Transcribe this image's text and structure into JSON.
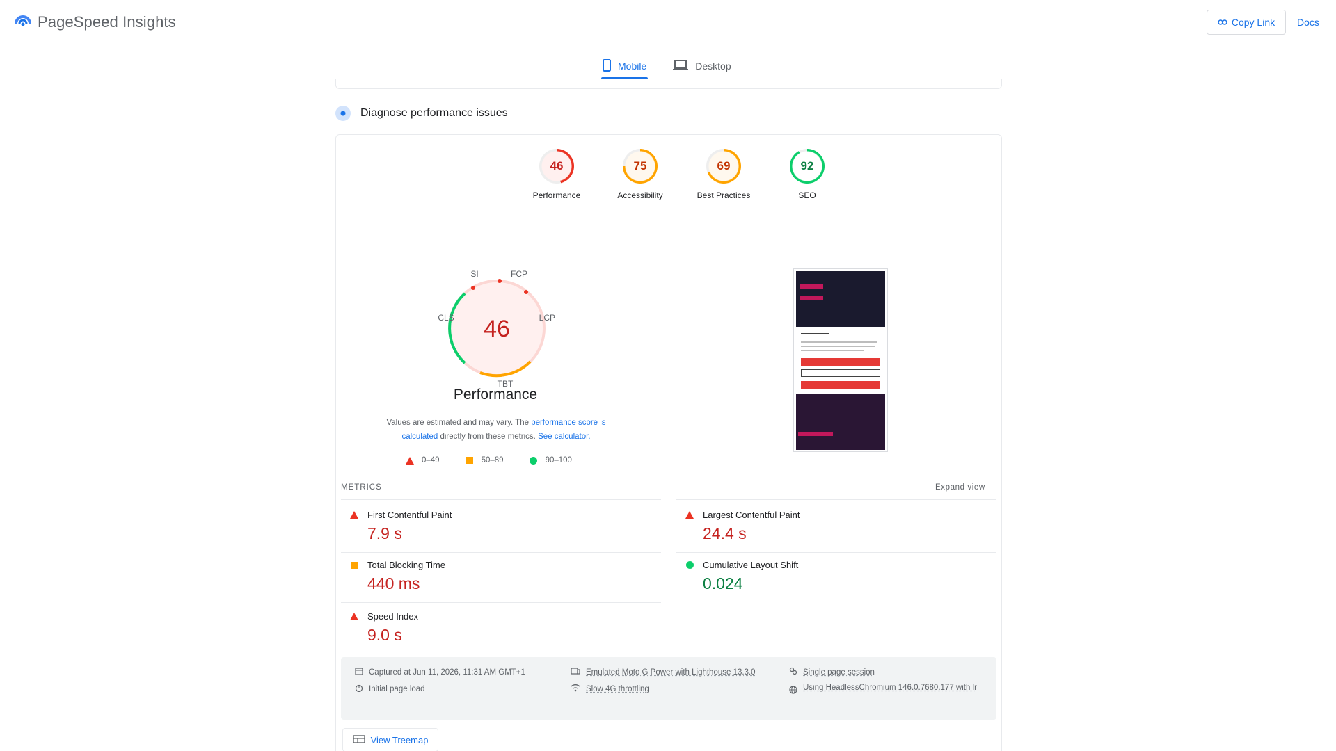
{
  "header": {
    "title": "PageSpeed Insights",
    "copy_link": "Copy Link",
    "docs": "Docs"
  },
  "tabs": [
    {
      "label": "Mobile",
      "active": true
    },
    {
      "label": "Desktop",
      "active": false
    }
  ],
  "diagnose": {
    "title": "Diagnose performance issues"
  },
  "categories": [
    {
      "score": "46",
      "label": "Performance",
      "status": "fail"
    },
    {
      "score": "75",
      "label": "Accessibility",
      "status": "average"
    },
    {
      "score": "69",
      "label": "Best Practices",
      "status": "average"
    },
    {
      "score": "92",
      "label": "SEO",
      "status": "pass"
    }
  ],
  "performance": {
    "score": "46",
    "title": "Performance",
    "gauge_labels": {
      "si": "SI",
      "fcp": "FCP",
      "lcp": "LCP",
      "tbt": "TBT",
      "cls": "CLS"
    },
    "note_pre": "Values are estimated and may vary. The ",
    "note_link": "performance score is calculated",
    "note_mid": " directly from these metrics. ",
    "note_calc": "See calculator."
  },
  "legend": [
    {
      "range": "0–49",
      "shape": "triangle",
      "color": "#eb3323"
    },
    {
      "range": "50–89",
      "shape": "square",
      "color": "#ffa400"
    },
    {
      "range": "90–100",
      "shape": "circle",
      "color": "#0cce6b"
    }
  ],
  "metrics": {
    "section_label": "METRICS",
    "expand_label": "Expand view",
    "items": [
      {
        "name": "First Contentful Paint",
        "value": "7.9 s",
        "status": "fail"
      },
      {
        "name": "Largest Contentful Paint",
        "value": "24.4 s",
        "status": "fail"
      },
      {
        "name": "Total Blocking Time",
        "value": "440 ms",
        "status": "average"
      },
      {
        "name": "Cumulative Layout Shift",
        "value": "0.024",
        "status": "pass"
      },
      {
        "name": "Speed Index",
        "value": "9.0 s",
        "status": "fail"
      }
    ]
  },
  "runtime": {
    "captured": "Captured at Jun 11, 2026, 11:31 AM GMT+1",
    "initial_load": "Initial page load",
    "device": "Emulated Moto G Power with Lighthouse 13.3.0",
    "throttling": "Slow 4G throttling",
    "session": "Single page session",
    "browser": "Using HeadlessChromium 146.0.7680.177 with lr"
  },
  "treemap": {
    "label": "View Treemap"
  },
  "colors": {
    "accent": "#1a73e8",
    "fail": "#eb3323",
    "average": "#ffa400",
    "pass": "#0cce6b"
  }
}
